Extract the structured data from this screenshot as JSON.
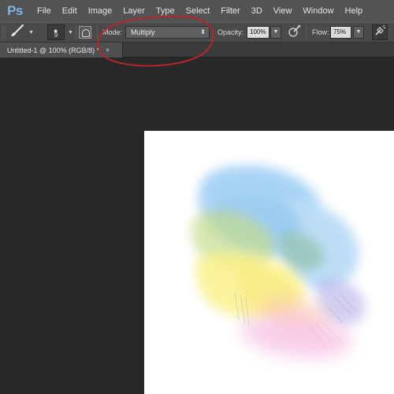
{
  "app": {
    "logo": "Ps"
  },
  "menu": [
    "File",
    "Edit",
    "Image",
    "Layer",
    "Type",
    "Select",
    "Filter",
    "3D",
    "View",
    "Window",
    "Help"
  ],
  "options_bar": {
    "tool_icon": "brush-icon",
    "brush_size": "9",
    "mode_label": "Mode:",
    "mode_value": "Multiply",
    "opacity_label": "Opacity:",
    "opacity_value": "100%",
    "flow_label": "Flow:",
    "flow_value": "75%"
  },
  "document_tab": {
    "title": "Untitled-1 @ 100% (RGB/8) *",
    "close": "×"
  },
  "annotation": {
    "color": "#b3262b",
    "shape": "ellipse"
  },
  "canvas": {
    "background": "#ffffff",
    "content": "watercolor-brush-strokes"
  }
}
